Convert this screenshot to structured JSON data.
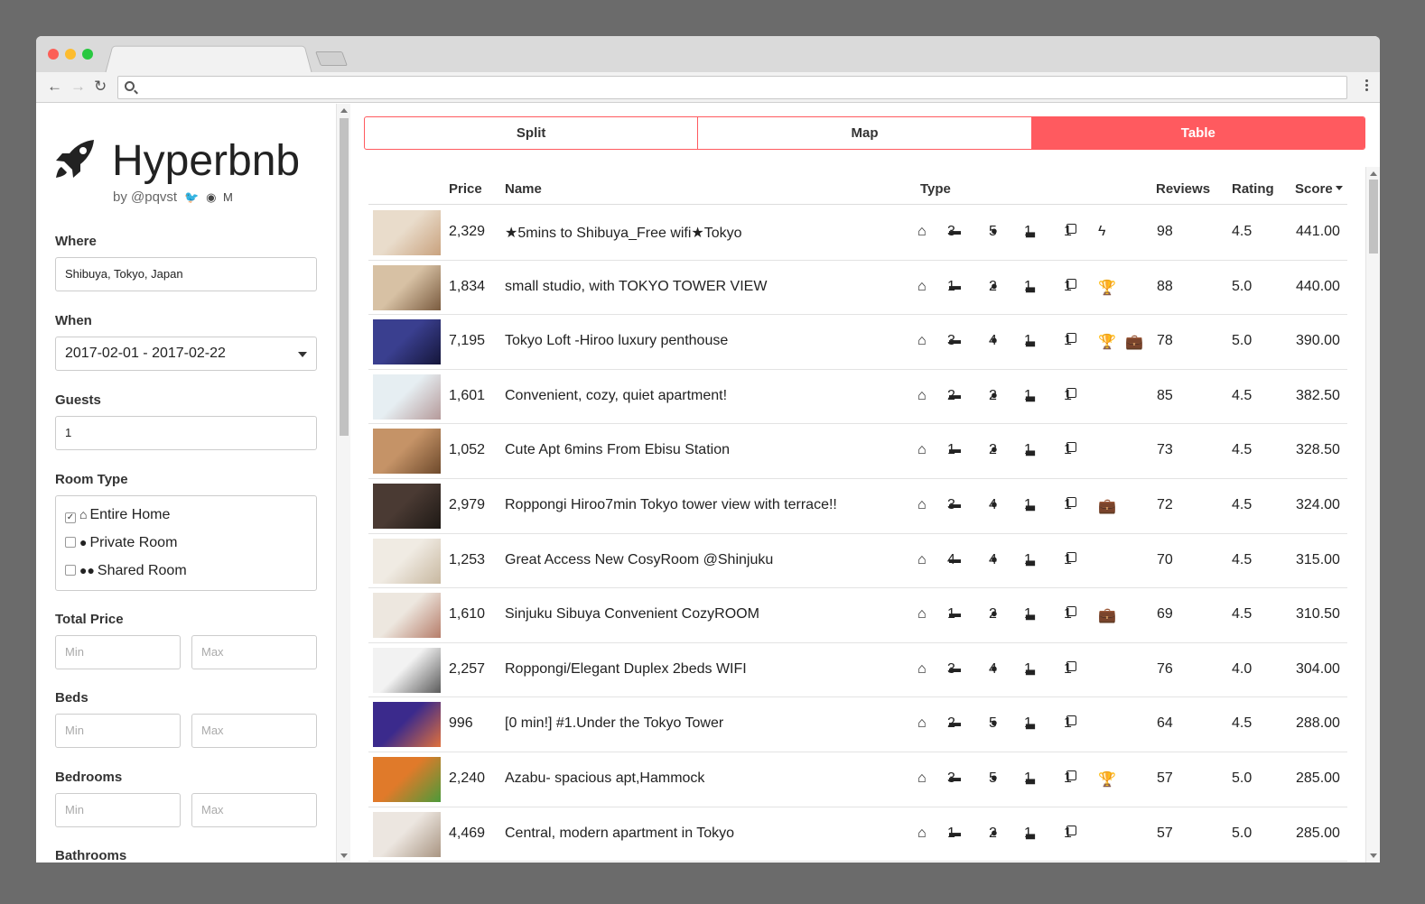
{
  "app": {
    "name": "Hyperbnb",
    "byline": "by @pqvst",
    "byline_icons": "🐦 ◉ M"
  },
  "colors": {
    "accent": "#ff5a5f",
    "text": "#222222",
    "muted": "#666666"
  },
  "filters": {
    "where": {
      "label": "Where",
      "value": "Shibuya, Tokyo, Japan"
    },
    "when": {
      "label": "When",
      "value": "2017-02-01 - 2017-02-22"
    },
    "guests": {
      "label": "Guests",
      "value": "1"
    },
    "room_type": {
      "label": "Room Type",
      "options": [
        {
          "label": "Entire Home",
          "checked": true,
          "icon": "home-icon",
          "glyph": "⌂"
        },
        {
          "label": "Private Room",
          "checked": false,
          "icon": "user-icon",
          "glyph": "●"
        },
        {
          "label": "Shared Room",
          "checked": false,
          "icon": "users-icon",
          "glyph": "●●"
        }
      ]
    },
    "total_price": {
      "label": "Total Price",
      "min_placeholder": "Min",
      "max_placeholder": "Max"
    },
    "beds": {
      "label": "Beds",
      "min_placeholder": "Min",
      "max_placeholder": "Max"
    },
    "bedrooms": {
      "label": "Bedrooms",
      "min_placeholder": "Min",
      "max_placeholder": "Max"
    },
    "bathrooms": {
      "label": "Bathrooms"
    }
  },
  "view_tabs": [
    {
      "label": "Split",
      "active": false
    },
    {
      "label": "Map",
      "active": false
    },
    {
      "label": "Table",
      "active": true
    }
  ],
  "table": {
    "headers": {
      "price": "Price",
      "name": "Name",
      "type": "Type",
      "reviews": "Reviews",
      "rating": "Rating",
      "score": "Score"
    },
    "rows": [
      {
        "price": "2,329",
        "name": "★5mins to Shibuya_Free wifi★Tokyo",
        "beds": "3",
        "guests": "5",
        "baths": "1",
        "bedrooms": "1",
        "extra": [
          "flash-icon"
        ],
        "reviews": "98",
        "rating": "4.5",
        "score": "441.00",
        "thumb": [
          "#e9dccb",
          "#c9a27e"
        ]
      },
      {
        "price": "1,834",
        "name": "small studio, with TOKYO TOWER VIEW",
        "beds": "1",
        "guests": "2",
        "baths": "1",
        "bedrooms": "1",
        "extra": [
          "trophy-icon"
        ],
        "reviews": "88",
        "rating": "5.0",
        "score": "440.00",
        "thumb": [
          "#d7c1a4",
          "#7a5b3f"
        ]
      },
      {
        "price": "7,195",
        "name": "Tokyo Loft -Hiroo luxury penthouse",
        "beds": "3",
        "guests": "4",
        "baths": "1",
        "bedrooms": "1",
        "extra": [
          "trophy-icon",
          "briefcase-icon"
        ],
        "reviews": "78",
        "rating": "5.0",
        "score": "390.00",
        "thumb": [
          "#3a3f8f",
          "#15163a"
        ]
      },
      {
        "price": "1,601",
        "name": "Convenient, cozy, quiet apartment!",
        "beds": "2",
        "guests": "2",
        "baths": "1",
        "bedrooms": "1",
        "extra": [],
        "reviews": "85",
        "rating": "4.5",
        "score": "382.50",
        "thumb": [
          "#e6eef2",
          "#b59a9a"
        ]
      },
      {
        "price": "1,052",
        "name": "Cute Apt 6mins From Ebisu Station",
        "beds": "1",
        "guests": "2",
        "baths": "1",
        "bedrooms": "1",
        "extra": [],
        "reviews": "73",
        "rating": "4.5",
        "score": "328.50",
        "thumb": [
          "#c59367",
          "#6e4a2c"
        ]
      },
      {
        "price": "2,979",
        "name": "Roppongi Hiroo7min Tokyo tower view with terrace!!",
        "beds": "3",
        "guests": "4",
        "baths": "1",
        "bedrooms": "1",
        "extra": [
          "briefcase-icon"
        ],
        "reviews": "72",
        "rating": "4.5",
        "score": "324.00",
        "thumb": [
          "#4a3a33",
          "#1e1915"
        ]
      },
      {
        "price": "1,253",
        "name": "Great Access New CosyRoom @Shinjuku",
        "beds": "4",
        "guests": "4",
        "baths": "1",
        "bedrooms": "1",
        "extra": [],
        "reviews": "70",
        "rating": "4.5",
        "score": "315.00",
        "thumb": [
          "#f0ebe3",
          "#c8b8a0"
        ]
      },
      {
        "price": "1,610",
        "name": "Sinjuku Sibuya Convenient CozyROOM",
        "beds": "1",
        "guests": "2",
        "baths": "1",
        "bedrooms": "1",
        "extra": [
          "briefcase-icon"
        ],
        "reviews": "69",
        "rating": "4.5",
        "score": "310.50",
        "thumb": [
          "#ede7df",
          "#b67d6a"
        ]
      },
      {
        "price": "2,257",
        "name": "Roppongi/Elegant Duplex 2beds WIFI",
        "beds": "3",
        "guests": "4",
        "baths": "1",
        "bedrooms": "1",
        "extra": [],
        "reviews": "76",
        "rating": "4.0",
        "score": "304.00",
        "thumb": [
          "#f2f2f2",
          "#5b5b5b"
        ]
      },
      {
        "price": "996",
        "name": "[0 min!] #1.Under the Tokyo Tower",
        "beds": "2",
        "guests": "5",
        "baths": "1",
        "bedrooms": "1",
        "extra": [],
        "reviews": "64",
        "rating": "4.5",
        "score": "288.00",
        "thumb": [
          "#3b2a8c",
          "#e0703c"
        ]
      },
      {
        "price": "2,240",
        "name": "Azabu- spacious apt,Hammock",
        "beds": "3",
        "guests": "5",
        "baths": "1",
        "bedrooms": "1",
        "extra": [
          "trophy-icon"
        ],
        "reviews": "57",
        "rating": "5.0",
        "score": "285.00",
        "thumb": [
          "#e07a2a",
          "#4d9a3a"
        ]
      },
      {
        "price": "4,469",
        "name": "Central, modern apartment in Tokyo",
        "beds": "1",
        "guests": "2",
        "baths": "1",
        "bedrooms": "1",
        "extra": [],
        "reviews": "57",
        "rating": "5.0",
        "score": "285.00",
        "thumb": [
          "#ece6e0",
          "#a99582"
        ]
      }
    ]
  }
}
